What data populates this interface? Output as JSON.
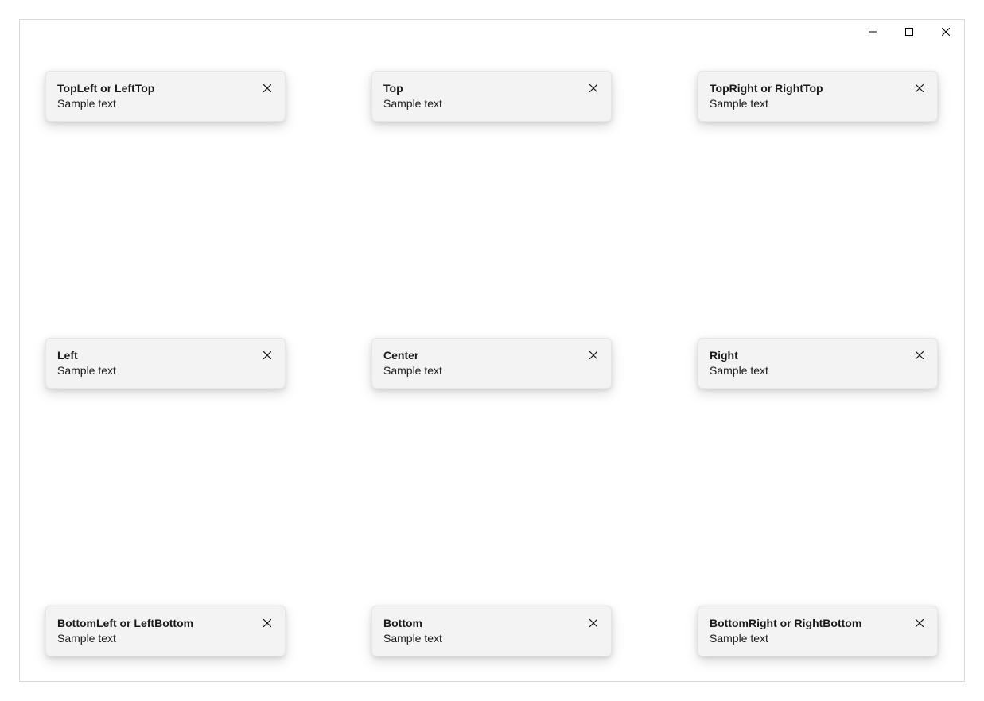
{
  "window": {
    "title": ""
  },
  "sample_text": "Sample text",
  "snackbars": {
    "top_left": {
      "title": "TopLeft or LeftTop",
      "text_key": "sample_text"
    },
    "top": {
      "title": "Top",
      "text_key": "sample_text"
    },
    "top_right": {
      "title": "TopRight or RightTop",
      "text_key": "sample_text"
    },
    "left": {
      "title": "Left",
      "text_key": "sample_text"
    },
    "center": {
      "title": "Center",
      "text_key": "sample_text"
    },
    "right": {
      "title": "Right",
      "text_key": "sample_text"
    },
    "bottom_left": {
      "title": "BottomLeft or LeftBottom",
      "text_key": "sample_text"
    },
    "bottom": {
      "title": "Bottom",
      "text_key": "sample_text"
    },
    "bottom_right": {
      "title": "BottomRight or RightBottom",
      "text_key": "sample_text"
    }
  }
}
